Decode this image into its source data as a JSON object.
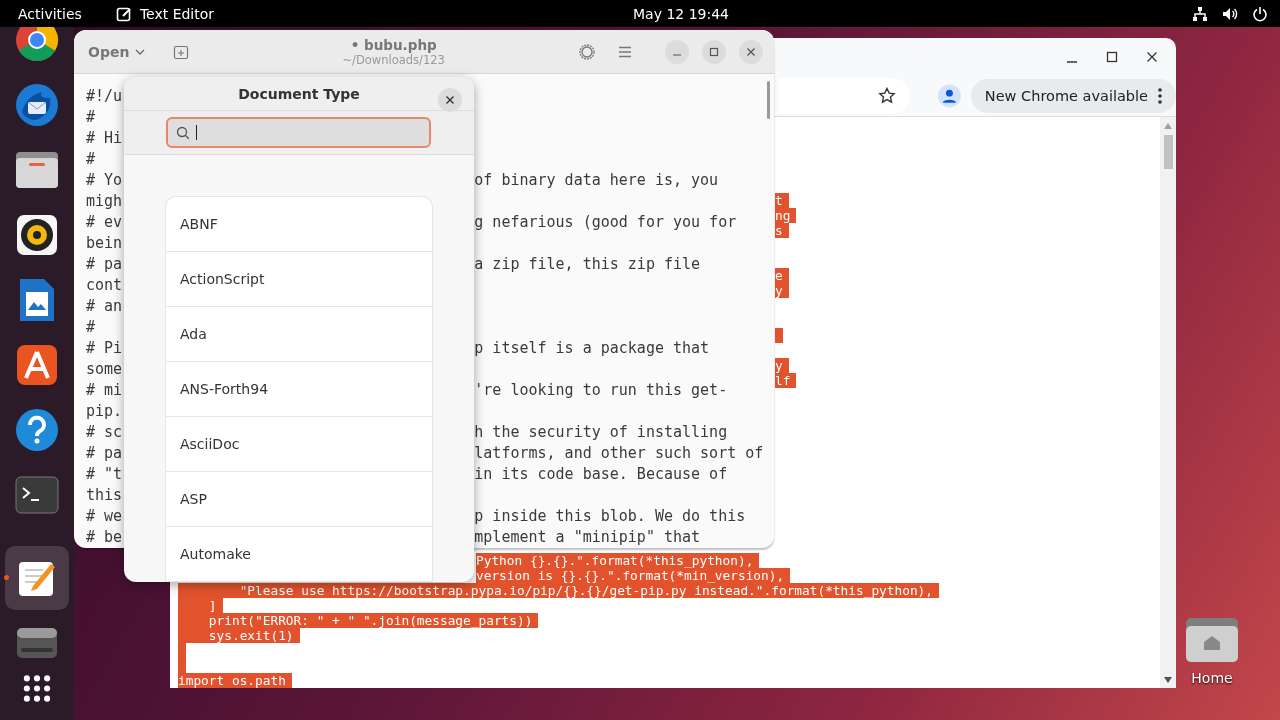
{
  "top_bar": {
    "activities": "Activities",
    "app_name": "Text Editor",
    "clock": "May 12  19:44"
  },
  "dock": {
    "items": [
      {
        "kind": "chrome",
        "selected": false
      },
      {
        "kind": "mail",
        "selected": false
      },
      {
        "kind": "files",
        "selected": false
      },
      {
        "kind": "music",
        "selected": false
      },
      {
        "kind": "writer",
        "selected": false
      },
      {
        "kind": "store",
        "selected": false
      },
      {
        "kind": "help",
        "selected": false
      },
      {
        "kind": "terminal",
        "selected": false
      },
      {
        "kind": "editor",
        "selected": true
      },
      {
        "kind": "drive",
        "selected": false
      }
    ]
  },
  "chrome": {
    "update_button": "New Chrome available",
    "upper_lines": [
      {
        "kind": "text",
        "text": "t"
      },
      {
        "kind": "text",
        "text": "ng"
      },
      {
        "kind": "text",
        "text": "s"
      },
      {
        "kind": "gap"
      },
      {
        "kind": "gap"
      },
      {
        "kind": "text",
        "text": "e"
      },
      {
        "kind": "text",
        "text": "y"
      },
      {
        "kind": "gap"
      },
      {
        "kind": "gap"
      },
      {
        "kind": "highlight"
      },
      {
        "kind": "gap"
      },
      {
        "kind": "text",
        "text": "y"
      },
      {
        "kind": "text",
        "text": "lf"
      }
    ],
    "lower_lines": [
      {
        "kind": "partial",
        "text": "Python {}.{}.\".format(*this_python),"
      },
      {
        "kind": "partial",
        "text": "version is {}.{}.\".format(*min_version),"
      },
      {
        "kind": "text",
        "text": "        \"Please use https://bootstrap.pypa.io/pip/{}.{}/get-pip.py instead.\".format(*this_python),"
      },
      {
        "kind": "text",
        "text": "    ]"
      },
      {
        "kind": "text",
        "text": "    print(\"ERROR: \" + \" \".join(message_parts))"
      },
      {
        "kind": "text",
        "text": "    sys.exit(1)"
      },
      {
        "kind": "highlight"
      },
      {
        "kind": "highlight"
      },
      {
        "kind": "text",
        "text": "import os.path"
      }
    ]
  },
  "editor": {
    "open_button": "Open",
    "title": "• bubu.php",
    "subtitle": "~/Downloads/123",
    "lines": [
      {
        "left": "#!/u"
      },
      {
        "left": "#"
      },
      {
        "left": "# Hi"
      },
      {
        "left": "#"
      },
      {
        "left": "# Yo",
        "right": "of binary data here is, you"
      },
      {
        "left": "migh"
      },
      {
        "left": "# ev",
        "right": "g nefarious (good for you for"
      },
      {
        "left": "bein"
      },
      {
        "left": "# pa",
        "right": "a zip file, this zip file"
      },
      {
        "left": "cont"
      },
      {
        "left": "# an"
      },
      {
        "left": "#"
      },
      {
        "left": "# Pi",
        "right": "p itself is a package that"
      },
      {
        "left": "some"
      },
      {
        "left": "# mi",
        "right": "'re looking to run this get-"
      },
      {
        "left": "pip."
      },
      {
        "left": "# sc",
        "right": "h the security of installing"
      },
      {
        "left": "# pa",
        "right": "latforms, and other such sort of"
      },
      {
        "left": "# \"t",
        "right": "in its code base. Because of"
      },
      {
        "left": "this"
      },
      {
        "left": "# we",
        "right": "p inside this blob. We do this"
      },
      {
        "left": "# be",
        "right": "mplement a \"minipip\" that"
      }
    ]
  },
  "popover": {
    "title": "Document Type",
    "search": {
      "focused": true
    },
    "items": [
      "ABNF",
      "ActionScript",
      "Ada",
      "ANS-Forth94",
      "AsciiDoc",
      "ASP",
      "Automake"
    ]
  },
  "desktop_icons": [
    {
      "label": "Home"
    }
  ]
}
